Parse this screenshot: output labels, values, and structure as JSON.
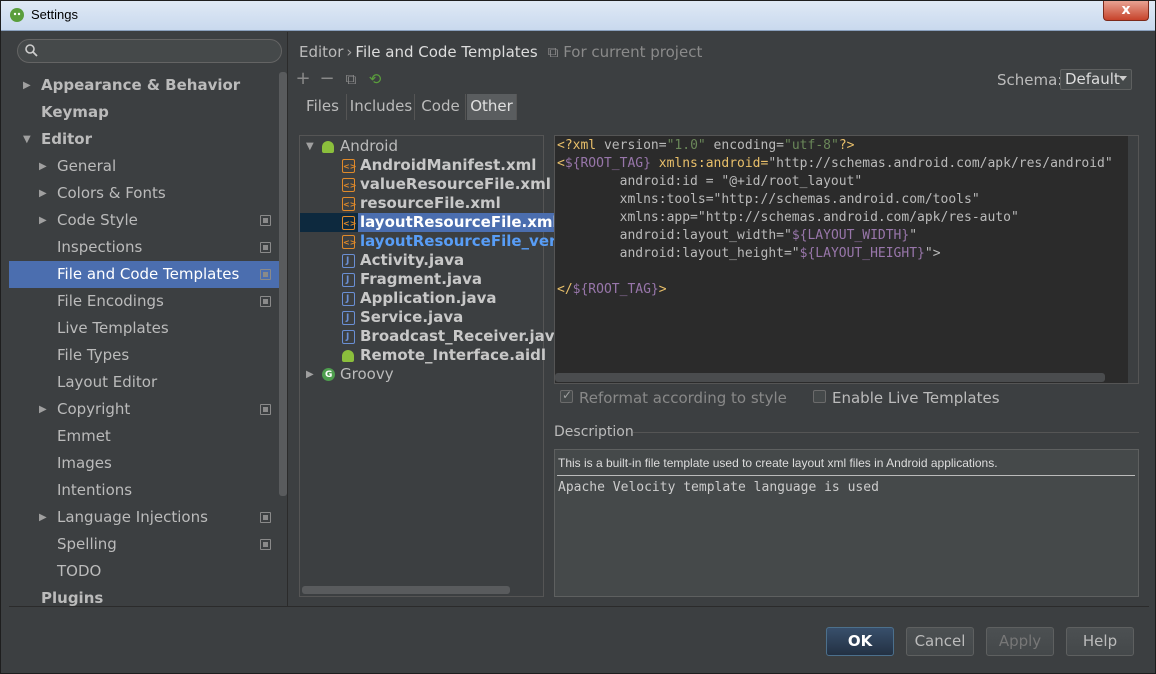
{
  "window": {
    "title": "Settings",
    "close_glyph": "x"
  },
  "search": {
    "placeholder": ""
  },
  "sidebar": {
    "items": [
      {
        "label": "Appearance & Behavior",
        "level": 0,
        "bold": true,
        "arrow": "right"
      },
      {
        "label": "Keymap",
        "level": 0,
        "bold": true
      },
      {
        "label": "Editor",
        "level": 0,
        "bold": true,
        "arrow": "down"
      },
      {
        "label": "General",
        "level": 1,
        "arrow": "right"
      },
      {
        "label": "Colors & Fonts",
        "level": 1,
        "arrow": "right"
      },
      {
        "label": "Code Style",
        "level": 1,
        "arrow": "right",
        "project": true
      },
      {
        "label": "Inspections",
        "level": 1,
        "project": true
      },
      {
        "label": "File and Code Templates",
        "level": 1,
        "project": true,
        "selected": true
      },
      {
        "label": "File Encodings",
        "level": 1,
        "project": true
      },
      {
        "label": "Live Templates",
        "level": 1
      },
      {
        "label": "File Types",
        "level": 1
      },
      {
        "label": "Layout Editor",
        "level": 1
      },
      {
        "label": "Copyright",
        "level": 1,
        "arrow": "right",
        "project": true
      },
      {
        "label": "Emmet",
        "level": 1
      },
      {
        "label": "Images",
        "level": 1
      },
      {
        "label": "Intentions",
        "level": 1
      },
      {
        "label": "Language Injections",
        "level": 1,
        "arrow": "right",
        "project": true
      },
      {
        "label": "Spelling",
        "level": 1,
        "project": true
      },
      {
        "label": "TODO",
        "level": 1
      },
      {
        "label": "Plugins",
        "level": 0,
        "bold": true
      }
    ]
  },
  "breadcrumb": {
    "root": "Editor",
    "separator": "›",
    "current": "File and Code Templates",
    "scope_note": "For current project"
  },
  "toolbar": {
    "add": "+",
    "remove": "−",
    "copy": "⧉",
    "reset": "⟲"
  },
  "schema": {
    "label": "Schema:",
    "value": "Default"
  },
  "tabs": [
    {
      "label": "Files"
    },
    {
      "label": "Includes"
    },
    {
      "label": "Code"
    },
    {
      "label": "Other",
      "active": true
    }
  ],
  "tree": [
    {
      "label": "Android",
      "depth": 0,
      "icon": "droid",
      "expanded": true
    },
    {
      "label": "AndroidManifest.xml",
      "depth": 1,
      "icon": "xml"
    },
    {
      "label": "valueResourceFile.xml",
      "depth": 1,
      "icon": "xml"
    },
    {
      "label": "resourceFile.xml",
      "depth": 1,
      "icon": "xml"
    },
    {
      "label": "layoutResourceFile.xml",
      "depth": 1,
      "icon": "xml",
      "selected": true
    },
    {
      "label": "layoutResourceFile_vertica",
      "depth": 1,
      "icon": "xml",
      "blue": true
    },
    {
      "label": "Activity.java",
      "depth": 1,
      "icon": "java"
    },
    {
      "label": "Fragment.java",
      "depth": 1,
      "icon": "java"
    },
    {
      "label": "Application.java",
      "depth": 1,
      "icon": "java"
    },
    {
      "label": "Service.java",
      "depth": 1,
      "icon": "java"
    },
    {
      "label": "Broadcast_Receiver.java",
      "depth": 1,
      "icon": "java"
    },
    {
      "label": "Remote_Interface.aidl",
      "depth": 1,
      "icon": "droid"
    },
    {
      "label": "Groovy",
      "depth": 0,
      "icon": "groovy",
      "expanded": false
    }
  ],
  "editor": {
    "lines": [
      [
        [
          "tag",
          "<?xml "
        ],
        [
          "attr",
          "version="
        ],
        [
          "str",
          "\"1.0\""
        ],
        [
          "attr",
          " encoding="
        ],
        [
          "str",
          "\"utf-8\""
        ],
        [
          "tag",
          "?>"
        ]
      ],
      [
        [
          "tag",
          "<"
        ],
        [
          "var",
          "${ROOT_TAG}"
        ],
        [
          "tag",
          " xmlns:android="
        ],
        [
          "attr",
          "\"http://schemas.android.com/apk/res/android\""
        ]
      ],
      [
        [
          "attr",
          "        android:id = \""
        ],
        [
          "attr",
          "@+id/root_layout"
        ],
        [
          "attr",
          "\""
        ]
      ],
      [
        [
          "attr",
          "        xmlns:tools=\"http://schemas.android.com/tools\""
        ]
      ],
      [
        [
          "attr",
          "        xmlns:app=\"http://schemas.android.com/apk/res-auto\""
        ]
      ],
      [
        [
          "attr",
          "        android:layout_width=\""
        ],
        [
          "var",
          "${LAYOUT_WIDTH}"
        ],
        [
          "attr",
          "\""
        ]
      ],
      [
        [
          "attr",
          "        android:layout_height=\""
        ],
        [
          "var",
          "${LAYOUT_HEIGHT}"
        ],
        [
          "attr",
          "\">"
        ]
      ],
      [
        [
          "attr",
          ""
        ]
      ],
      [
        [
          "tag",
          "</"
        ],
        [
          "var",
          "${ROOT_TAG}"
        ],
        [
          "tag",
          ">"
        ]
      ]
    ]
  },
  "options": {
    "reformat": {
      "label": "Reformat according to style",
      "checked": true,
      "disabled": true
    },
    "live_templates": {
      "label": "Enable Live Templates",
      "checked": false
    }
  },
  "description": {
    "label": "Description",
    "line1": "This is a built-in file template used to create layout xml files in Android applications.",
    "line2": "Apache Velocity template language is used"
  },
  "buttons": {
    "ok": "OK",
    "cancel": "Cancel",
    "apply": "Apply",
    "help": "Help"
  },
  "colors": {
    "selection": "#4b6eaf",
    "background": "#3c3f41",
    "editor_bg": "#2b2b2b",
    "link_blue": "#589df6"
  }
}
